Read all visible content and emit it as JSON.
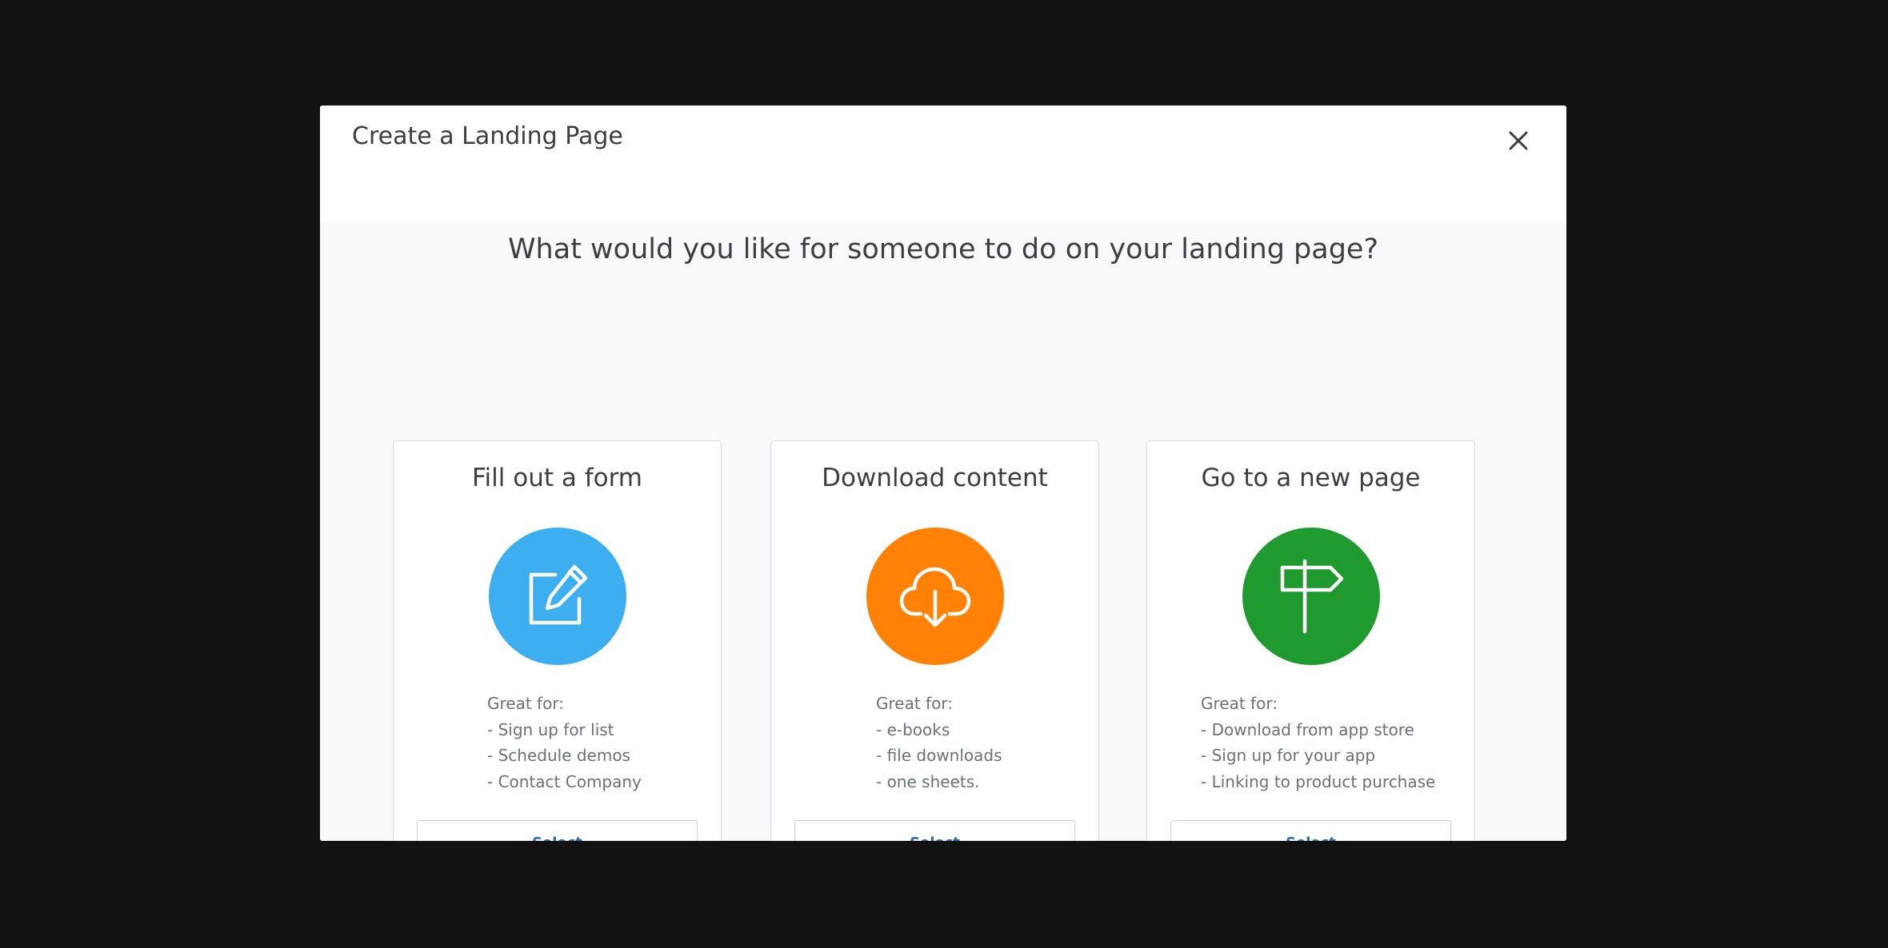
{
  "modal": {
    "title": "Create a Landing Page",
    "close_icon": "close-icon",
    "question": "What would you like for someone to do on your landing page?"
  },
  "cards": [
    {
      "title": "Fill out a form",
      "icon": "edit-form-icon",
      "icon_color": "#3daef0",
      "desc_heading": "Great for:",
      "items": [
        "- Sign up for list",
        "- Schedule demos",
        "- Contact Company"
      ],
      "button_label": "Select"
    },
    {
      "title": "Download content",
      "icon": "cloud-download-icon",
      "icon_color": "#ff8206",
      "desc_heading": "Great for:",
      "items": [
        "- e-books",
        "- file downloads",
        "- one sheets."
      ],
      "button_label": "Select"
    },
    {
      "title": "Go to a new page",
      "icon": "signpost-icon",
      "icon_color": "#1e9a2e",
      "desc_heading": "Great for:",
      "items": [
        "- Download from app store",
        "- Sign up for your app",
        "- Linking to product purchase"
      ],
      "button_label": "Select"
    }
  ],
  "colors": {
    "button_text": "#2f6ea6",
    "backdrop": "#121212",
    "body_background": "#f8f9fb"
  }
}
